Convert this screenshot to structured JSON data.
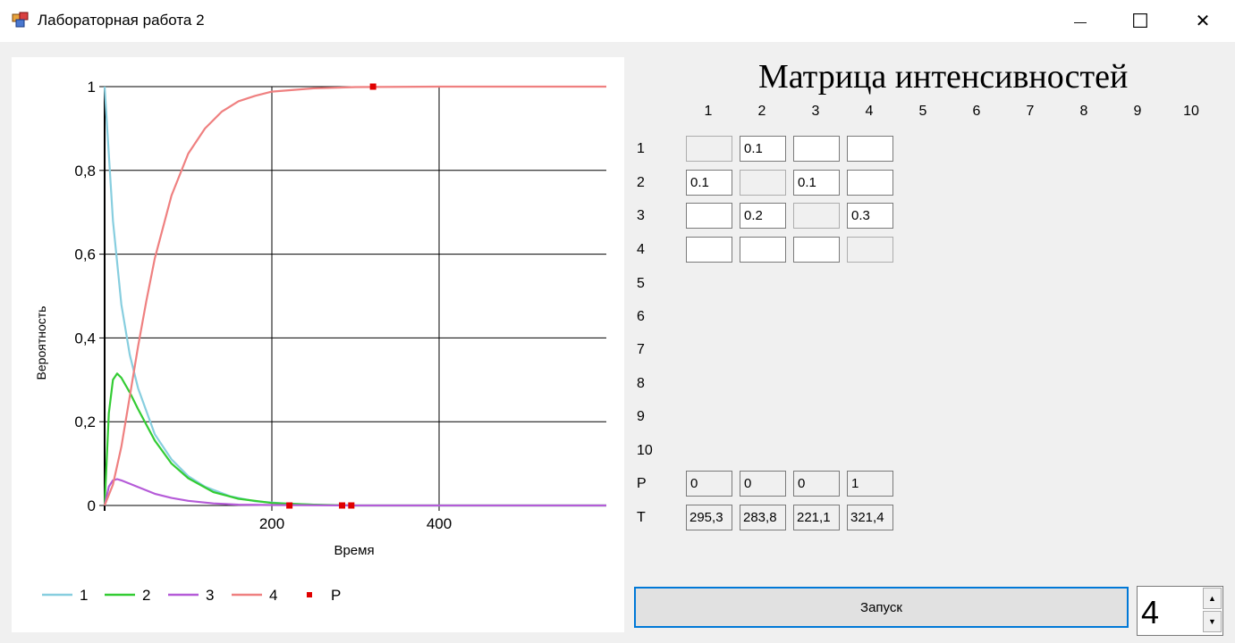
{
  "window": {
    "title": "Лабораторная работа 2",
    "minimize_glyph": "—",
    "maximize_glyph": "☐",
    "close_glyph": "✕"
  },
  "chart_data": {
    "type": "line",
    "xlabel": "Время",
    "ylabel": "Вероятность",
    "xlim": [
      0,
      600
    ],
    "ylim": [
      0,
      1
    ],
    "x_ticks": [
      {
        "value": 200,
        "label": "200"
      },
      {
        "value": 400,
        "label": "400"
      }
    ],
    "y_ticks": [
      {
        "value": 0,
        "label": "0"
      },
      {
        "value": 0.2,
        "label": "0,2"
      },
      {
        "value": 0.4,
        "label": "0,4"
      },
      {
        "value": 0.6,
        "label": "0,6"
      },
      {
        "value": 0.8,
        "label": "0,8"
      },
      {
        "value": 1,
        "label": "1"
      }
    ],
    "grid": true,
    "legend_position": "bottom",
    "series": [
      {
        "name": "1",
        "color": "#87cedf",
        "x": [
          0,
          10,
          20,
          30,
          40,
          60,
          80,
          100,
          120,
          150,
          180,
          220,
          260,
          300,
          400,
          600
        ],
        "y": [
          1,
          0.68,
          0.48,
          0.36,
          0.28,
          0.17,
          0.11,
          0.07,
          0.045,
          0.022,
          0.01,
          0.004,
          0.001,
          0,
          0,
          0
        ]
      },
      {
        "name": "2",
        "color": "#33cc33",
        "x": [
          0,
          5,
          10,
          15,
          20,
          30,
          40,
          60,
          80,
          100,
          130,
          160,
          200,
          250,
          300,
          400,
          600
        ],
        "y": [
          0,
          0.22,
          0.3,
          0.315,
          0.305,
          0.27,
          0.23,
          0.155,
          0.1,
          0.065,
          0.032,
          0.016,
          0.006,
          0.002,
          0,
          0,
          0
        ]
      },
      {
        "name": "3",
        "color": "#b55bd8",
        "x": [
          0,
          5,
          10,
          15,
          20,
          30,
          40,
          60,
          80,
          100,
          130,
          160,
          200,
          300,
          600
        ],
        "y": [
          0,
          0.045,
          0.06,
          0.063,
          0.06,
          0.052,
          0.044,
          0.028,
          0.018,
          0.011,
          0.005,
          0.002,
          0.001,
          0,
          0
        ]
      },
      {
        "name": "4",
        "color": "#ef8080",
        "x": [
          0,
          10,
          20,
          30,
          40,
          50,
          60,
          80,
          100,
          120,
          140,
          160,
          180,
          200,
          250,
          300,
          400,
          600
        ],
        "y": [
          0,
          0.05,
          0.14,
          0.26,
          0.38,
          0.49,
          0.59,
          0.74,
          0.84,
          0.9,
          0.94,
          0.965,
          0.978,
          0.988,
          0.996,
          0.999,
          1,
          1
        ]
      }
    ],
    "markers": {
      "name": "P",
      "color": "#e00000",
      "points": [
        {
          "x": 221,
          "y": 0
        },
        {
          "x": 284,
          "y": 0
        },
        {
          "x": 295,
          "y": 0
        },
        {
          "x": 321,
          "y": 1
        }
      ]
    }
  },
  "matrix": {
    "title": "Матрица интенсивностей",
    "column_headers": [
      "1",
      "2",
      "3",
      "4",
      "5",
      "6",
      "7",
      "8",
      "9",
      "10"
    ],
    "row_headers": [
      "1",
      "2",
      "3",
      "4",
      "5",
      "6",
      "7",
      "8",
      "9",
      "10",
      "P",
      "T"
    ],
    "cells": [
      [
        "",
        "0.1",
        "",
        ""
      ],
      [
        "0.1",
        "",
        "0.1",
        ""
      ],
      [
        "",
        "0.2",
        "",
        "0.3"
      ],
      [
        "",
        "",
        "",
        ""
      ]
    ],
    "p_values": [
      "0",
      "0",
      "0",
      "1"
    ],
    "t_values": [
      "295,3",
      "283,8",
      "221,1",
      "321,4"
    ]
  },
  "controls": {
    "run_label": "Запуск",
    "state_count": "4",
    "spin_up": "▲",
    "spin_down": "▼"
  }
}
